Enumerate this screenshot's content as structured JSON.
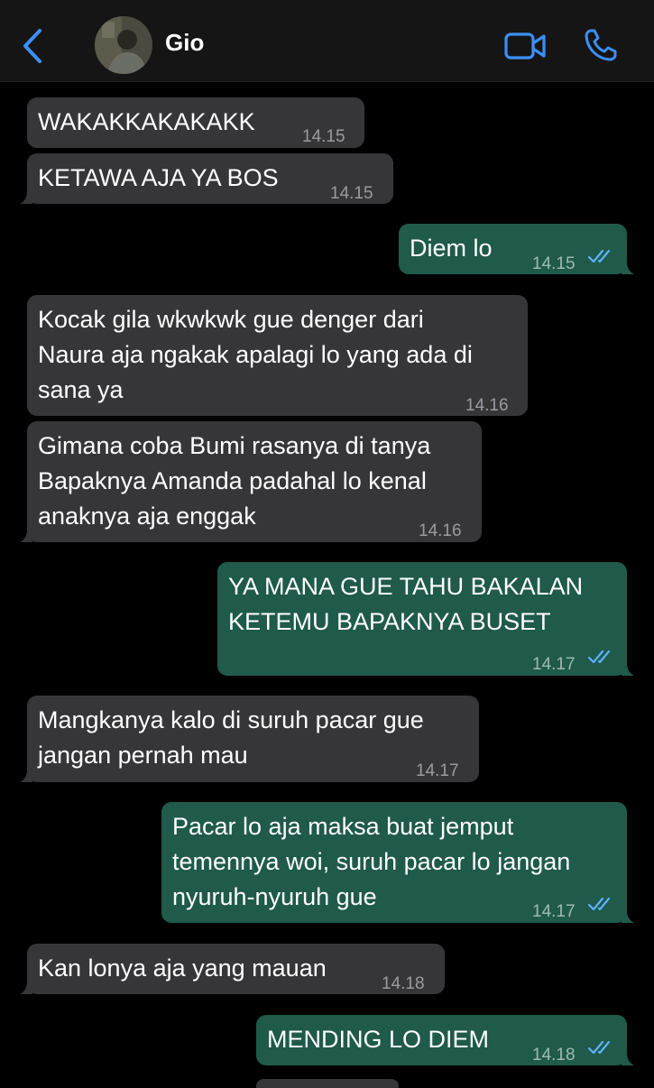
{
  "header": {
    "contact_name": "Gio",
    "back_icon": "chevron-left-icon",
    "video_icon": "video-camera-icon",
    "call_icon": "phone-icon",
    "accent_color": "#3c8ff5"
  },
  "messages": [
    {
      "direction": "incoming",
      "text": "WAKAKKAKAKAKK",
      "time": "14.15"
    },
    {
      "direction": "incoming",
      "text": "KETAWA AJA YA BOS",
      "time": "14.15"
    },
    {
      "direction": "outgoing",
      "text": "Diem lo",
      "time": "14.15",
      "status": "read"
    },
    {
      "direction": "incoming",
      "text": "Kocak gila wkwkwk gue denger dari Naura aja ngakak apalagi lo yang ada di sana ya",
      "time": "14.16"
    },
    {
      "direction": "incoming",
      "text": "Gimana coba Bumi rasanya di tanya Bapaknya Amanda padahal lo kenal anaknya aja enggak",
      "time": "14.16"
    },
    {
      "direction": "outgoing",
      "text": "YA MANA GUE TAHU BAKALAN KETEMU BAPAKNYA BUSET",
      "time": "14.17",
      "status": "read"
    },
    {
      "direction": "incoming",
      "text": "Mangkanya kalo di suruh pacar gue jangan pernah mau",
      "time": "14.17"
    },
    {
      "direction": "outgoing",
      "text": "Pacar lo aja maksa buat jemput temennya woi, suruh pacar lo jangan nyuruh-nyuruh gue",
      "time": "14.17",
      "status": "read"
    },
    {
      "direction": "incoming",
      "text": "Kan lonya aja yang mauan",
      "time": "14.18"
    },
    {
      "direction": "outgoing",
      "text": "MENDING LO DIEM",
      "time": "14.18",
      "status": "read"
    }
  ],
  "colors": {
    "incoming_bubble": "#363638",
    "outgoing_bubble": "#1f5a4a",
    "read_ticks": "#5fb0ff",
    "background": "#000000"
  }
}
